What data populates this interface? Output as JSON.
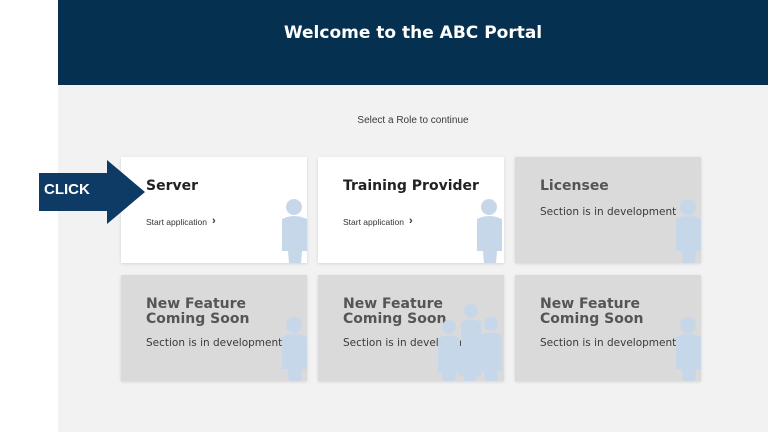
{
  "header": {
    "title": "Welcome to the ABC Portal"
  },
  "prompt": "Select a Role to continue",
  "annotation": {
    "label": "CLICK",
    "color": "#0e3a66"
  },
  "colors": {
    "header_bg": "#05304f",
    "page_bg": "#f2f2f2",
    "card_active": "#ffffff",
    "card_disabled": "#dadada",
    "icon_tint": "#c7d7ea"
  },
  "cards": [
    {
      "title": "Server",
      "link": "Start application",
      "link_icon": "chevron-right-icon",
      "icon": "person-icon"
    },
    {
      "title": "Training Provider",
      "link": "Start application",
      "link_icon": "chevron-right-icon",
      "icon": "person-icon"
    },
    {
      "title": "Licensee",
      "status": "Section is in development",
      "icon": "person-icon"
    },
    {
      "title": "New Feature Coming Soon",
      "status": "Section is in development",
      "icon": "person-icon"
    },
    {
      "title": "New Feature Coming Soon",
      "status": "Section is in development",
      "icon": "group-icon"
    },
    {
      "title": "New Feature Coming Soon",
      "status": "Section is in development",
      "icon": "person-icon"
    }
  ]
}
